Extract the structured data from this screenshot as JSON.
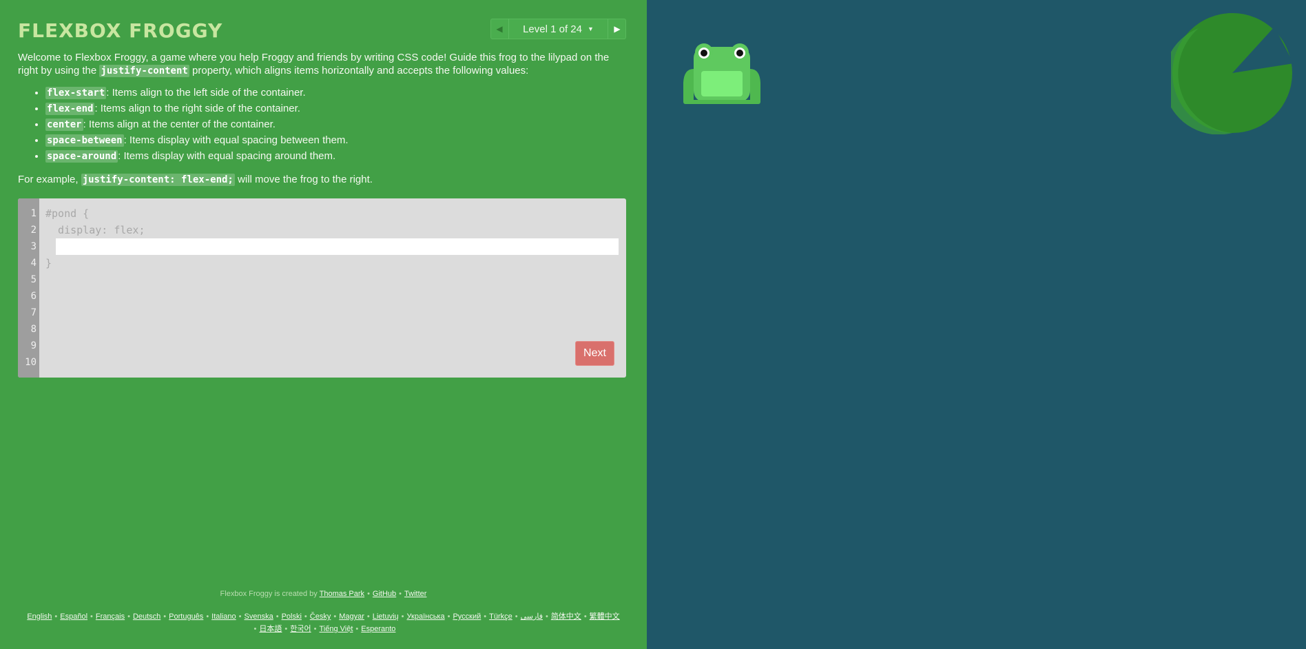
{
  "header": {
    "title": "FLEXBOX FROGGY",
    "level_label": "Level 1 of 24",
    "prev_arrow": "◀",
    "next_arrow": "▶",
    "caret": "▼"
  },
  "instructions": {
    "intro_a": "Welcome to Flexbox Froggy, a game where you help Froggy and friends by writing CSS code! Guide this frog to the lilypad on the right by using the ",
    "intro_code": "justify-content",
    "intro_b": " property, which aligns items horizontally and accepts the following values:",
    "values": [
      {
        "code": "flex-start",
        "text": ": Items align to the left side of the container."
      },
      {
        "code": "flex-end",
        "text": ": Items align to the right side of the container."
      },
      {
        "code": "center",
        "text": ": Items align at the center of the container."
      },
      {
        "code": "space-between",
        "text": ": Items display with equal spacing between them."
      },
      {
        "code": "space-around",
        "text": ": Items display with equal spacing around them."
      }
    ],
    "example_a": "For example, ",
    "example_code": "justify-content: flex-end;",
    "example_b": " will move the frog to the right."
  },
  "editor": {
    "line_numbers": [
      "1",
      "2",
      "3",
      "4",
      "5",
      "6",
      "7",
      "8",
      "9",
      "10"
    ],
    "line1": "#pond {",
    "line2": "  display: flex;",
    "line4": "}",
    "input_value": "",
    "next_label": "Next"
  },
  "footer": {
    "credit_prefix": "Flexbox Froggy is created by",
    "author": "Thomas Park",
    "github": "GitHub",
    "twitter": "Twitter",
    "languages_line1": [
      "English",
      "Español",
      "Français",
      "Deutsch",
      "Português",
      "Italiano",
      "Svenska",
      "Polski",
      "Česky",
      "Magyar",
      "Lietuvių",
      "Українська",
      "Русский",
      "Türkçe",
      "فارسی",
      "简体中文",
      "繁體中文"
    ],
    "languages_line2": [
      "日本語",
      "한국어",
      "Tiếng Việt",
      "Esperanto"
    ]
  },
  "colors": {
    "sidebar": "#42a046",
    "board": "#1f5768",
    "frog": "#5fc95f",
    "lilypad": "#2e8a2a",
    "next_button": "#d9706c"
  },
  "icons": {
    "prev": "triangle-left-icon",
    "next": "triangle-right-icon",
    "dropdown": "caret-down-icon"
  }
}
